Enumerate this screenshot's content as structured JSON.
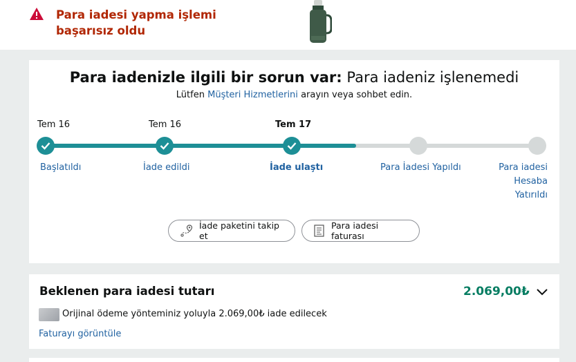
{
  "alert": {
    "icon": "warning-icon",
    "message": "Para iadesi yapma işlemi başarısız oldu"
  },
  "status_card": {
    "headline_strong": "Para iadenizle ilgili bir sorun var:",
    "headline_rest": "Para iadeniz işlenemedi",
    "subline_before": "Lütfen",
    "subline_link": "Müşteri Hizmetlerini",
    "subline_after": "arayın veya sohbet edin.",
    "steps": [
      {
        "date": "Tem 16",
        "label": "Başlatıldı",
        "done": true
      },
      {
        "date": "Tem 16",
        "label": "İade edildi",
        "done": true
      },
      {
        "date": "Tem 17",
        "label": "İade ulaştı",
        "done": true,
        "current": true
      },
      {
        "date": "",
        "label": "Para İadesi Yapıldı",
        "done": false
      },
      {
        "date": "",
        "label": "Para iadesi Hesaba Yatırıldı",
        "done": false
      }
    ],
    "progress": 0.62,
    "buttons": {
      "track": "İade paketini takip et",
      "invoice": "Para iadesi faturası"
    }
  },
  "amount_card": {
    "title": "Beklenen para iadesi tutarı",
    "amount": "2.069,00₺",
    "method_text": "Orijinal ödeme yönteminiz yoluyla 2.069,00₺ iade edilecek",
    "invoice_link": "Faturayı görüntüle"
  },
  "colors": {
    "accent": "#1d8f96",
    "alert": "#b12704",
    "link": "#2162a1",
    "amount": "#067d62"
  }
}
